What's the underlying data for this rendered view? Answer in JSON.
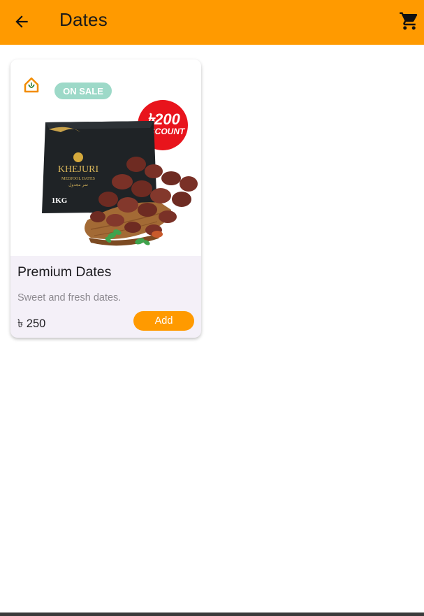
{
  "appbar": {
    "title": "Dates",
    "background": "#FF9A00",
    "back_icon": "arrow-back-icon",
    "cart_icon": "shopping-cart-icon"
  },
  "products": [
    {
      "name": "Premium Dates",
      "description": "Sweet and fresh dates.",
      "price": "৳ 250",
      "add_label": "Add",
      "image": {
        "sale_badge": "ON SALE",
        "discount_amount": "৳200",
        "discount_label": "DISCOUNT",
        "brand": "KHEJURI",
        "box_subtitle": "MEDJOOL DATES",
        "box_arabic": "تمر مجدول",
        "box_weight": "1KG"
      }
    }
  ]
}
